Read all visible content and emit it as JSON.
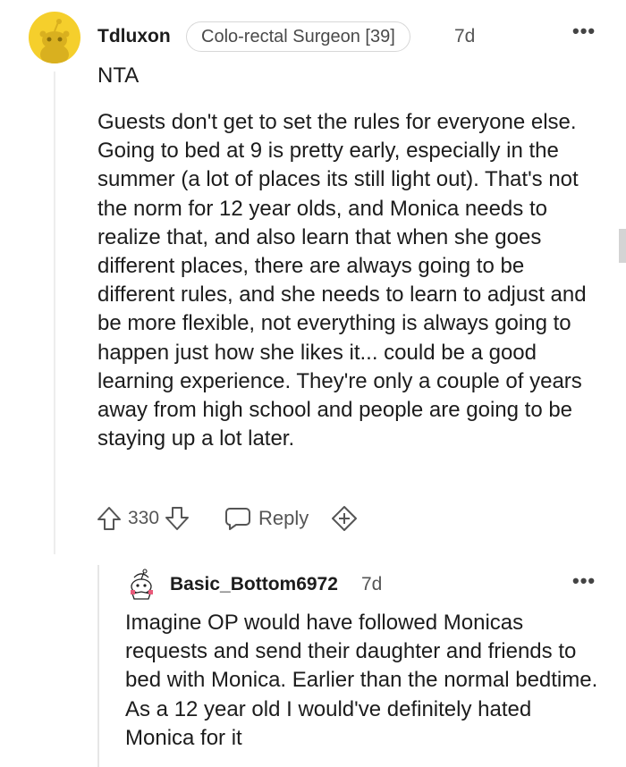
{
  "comment": {
    "username": "Tdluxon",
    "flair": "Colo-rectal Surgeon [39]",
    "time": "7d",
    "verdict": "NTA",
    "body": "Guests don't get to set the rules for everyone else. Going to bed at 9 is pretty early, especially in the summer (a lot of places its still light out). That's not the norm for 12 year olds, and Monica needs to realize that, and also learn that when she goes different places, there are always going to be different rules, and she needs to learn to adjust and be more flexible, not everything is always going to happen just how she likes it... could be a good learning experience. They're only a couple of years away from high school and people are going to be staying up a lot later.",
    "score": "330",
    "reply_label": "Reply",
    "more_label": "•••",
    "avatar_color": "#f5cf2c"
  },
  "reply": {
    "username": "Basic_Bottom6972",
    "time": "7d",
    "body": "Imagine OP would have followed Monicas requests and send their daughter and friends to bed with Monica. Earlier than the normal bedtime. As a 12 year old I would've definitely hated Monica for it",
    "more_label": "•••"
  },
  "icons": [
    "avatar-icon",
    "upvote-icon",
    "downvote-icon",
    "reply-icon",
    "award-icon",
    "more-icon"
  ]
}
